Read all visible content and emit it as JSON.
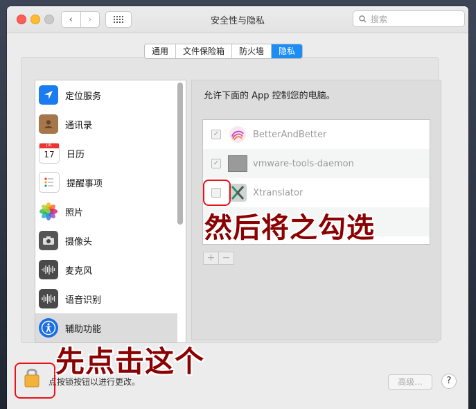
{
  "window": {
    "title": "安全性与隐私"
  },
  "toolbar": {
    "back_glyph": "‹",
    "forward_glyph": "›"
  },
  "search": {
    "placeholder": "搜索"
  },
  "tabs": [
    {
      "label": "通用",
      "active": false
    },
    {
      "label": "文件保险箱",
      "active": false
    },
    {
      "label": "防火墙",
      "active": false
    },
    {
      "label": "隐私",
      "active": true
    }
  ],
  "sidebar": {
    "items": [
      {
        "label": "定位服务",
        "icon": "location-icon"
      },
      {
        "label": "通讯录",
        "icon": "contacts-icon"
      },
      {
        "label": "日历",
        "icon": "calendar-icon",
        "icon_text": "17",
        "icon_month": "JUL"
      },
      {
        "label": "提醒事项",
        "icon": "reminders-icon"
      },
      {
        "label": "照片",
        "icon": "photos-icon"
      },
      {
        "label": "摄像头",
        "icon": "camera-icon"
      },
      {
        "label": "麦克风",
        "icon": "microphone-icon"
      },
      {
        "label": "语音识别",
        "icon": "speech-recognition-icon"
      },
      {
        "label": "辅助功能",
        "icon": "accessibility-icon",
        "selected": true
      }
    ]
  },
  "main": {
    "description": "允许下面的 App 控制您的电脑。",
    "apps": [
      {
        "name": "BetterAndBetter",
        "checked": true,
        "icon": "betterandbetter-icon"
      },
      {
        "name": "vmware-tools-daemon",
        "checked": true,
        "icon": "vmware-icon"
      },
      {
        "name": "Xtranslator",
        "checked": false,
        "icon": "xtranslator-icon"
      }
    ],
    "add_label": "+",
    "remove_label": "−"
  },
  "footer": {
    "lock_text": "点按锁按钮以进行更改。",
    "advanced_label": "高级...",
    "help_label": "?"
  },
  "annotations": {
    "step2": "然后将之勾选",
    "step1": "先点击这个"
  },
  "colors": {
    "accent": "#1b8df5",
    "annotation_text": "#8b0000",
    "highlight_box": "#e8121d"
  }
}
